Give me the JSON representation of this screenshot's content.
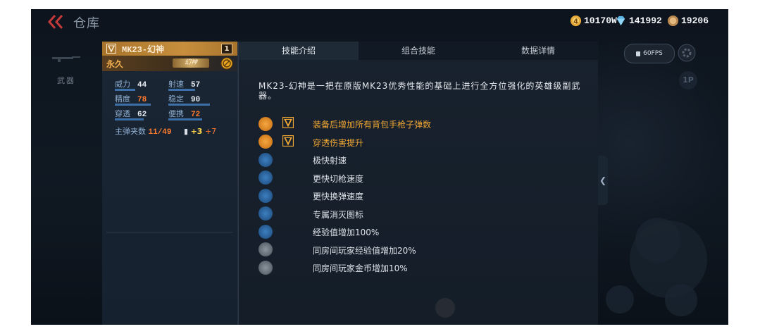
{
  "header": {
    "title": "仓库",
    "currencies": [
      {
        "icon": "gold-coin-icon",
        "value": "10170W",
        "color": "#e7a938"
      },
      {
        "icon": "diamond-icon",
        "value": "141992",
        "color": "#5ab4e8"
      },
      {
        "icon": "honor-coin-icon",
        "value": "19206",
        "color": "#d29a5a"
      }
    ]
  },
  "nav": {
    "weapon_label": "武器"
  },
  "weapon": {
    "name": "MK23-幻神",
    "level": "1",
    "duration": "永久",
    "tag": "幻神",
    "stats": [
      {
        "label": "威力",
        "value": "44",
        "highlight": false,
        "level": 0.44
      },
      {
        "label": "射速",
        "value": "57",
        "highlight": false,
        "level": 0.57
      },
      {
        "label": "精度",
        "value": "78",
        "highlight": true,
        "level": 0.78
      },
      {
        "label": "稳定",
        "value": "90",
        "highlight": false,
        "level": 0.9
      },
      {
        "label": "穿透",
        "value": "62",
        "highlight": false,
        "level": 0.62
      },
      {
        "label": "便携",
        "value": "72",
        "highlight": true,
        "level": 0.72
      }
    ],
    "magazine_label": "主弹夹数",
    "magazine_value": "11/49",
    "bonus_a": "+3",
    "bonus_b": "+7"
  },
  "tabs": [
    "技能介绍",
    "组合技能",
    "数据详情"
  ],
  "description": "MK23-幻神是一把在原版MK23优秀性能的基础上进行全方位强化的英雄级副武器。",
  "perks": [
    {
      "text": "装备后增加所有背包手枪子弹数",
      "gold": true,
      "hero": true,
      "icon": "pistol-ammo-icon"
    },
    {
      "text": "穿透伤害提升",
      "gold": true,
      "hero": true,
      "icon": "penetration-icon"
    },
    {
      "text": "极快射速",
      "gold": false,
      "hero": false,
      "icon": "fire-rate-icon"
    },
    {
      "text": "更快切枪速度",
      "gold": false,
      "hero": false,
      "icon": "switch-weapon-icon"
    },
    {
      "text": "更快换弹速度",
      "gold": false,
      "hero": false,
      "icon": "reload-icon"
    },
    {
      "text": "专属消灭图标",
      "gold": false,
      "hero": false,
      "icon": "kill-icon"
    },
    {
      "text": "经验值增加100%",
      "gold": false,
      "hero": false,
      "icon": "exp-icon"
    },
    {
      "text": "同房间玩家经验值增加20%",
      "gold": false,
      "hero": false,
      "icon": "room-exp-icon"
    },
    {
      "text": "同房间玩家金币增加10%",
      "gold": false,
      "hero": false,
      "icon": "room-coin-icon"
    }
  ],
  "hud": {
    "fps_label": "60FPS",
    "player_tag": "1P"
  }
}
